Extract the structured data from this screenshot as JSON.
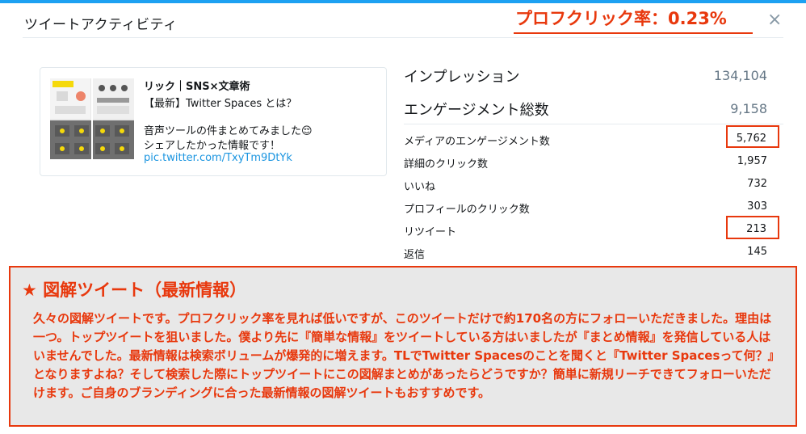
{
  "window": {
    "title": "ツイートアクティビティ",
    "close_glyph": "×",
    "accent_color": "#1da1f2"
  },
  "annotation": {
    "header_note": "プロフクリック率：0.23%",
    "color": "#e8380d"
  },
  "tweet": {
    "author": "リック｜SNS×文章術",
    "lines": [
      "【最新】Twitter Spaces とは？",
      "",
      "音声ツールの件まとめてみました😌",
      "シェアしたかった情報です！"
    ],
    "link": "pic.twitter.com/TxyTm9DtYk",
    "thumbnail_icon": "image-icon"
  },
  "metrics": {
    "impressions": {
      "label": "インプレッション",
      "value": "134,104"
    },
    "engagements": {
      "label": "エンゲージメント総数",
      "value": "9,158"
    },
    "rows": [
      {
        "label": "メディアのエンゲージメント数",
        "value": "5,762"
      },
      {
        "label": "詳細のクリック数",
        "value": "1,957"
      },
      {
        "label": "いいね",
        "value": "732"
      },
      {
        "label": "プロフィールのクリック数",
        "value": "303"
      },
      {
        "label": "リツイート",
        "value": "213"
      },
      {
        "label": "返信",
        "value": "145"
      }
    ]
  },
  "note": {
    "title": "★ 図解ツイート（最新情報）",
    "body": "久々の図解ツイートです。プロフクリック率を見れば低いですが、このツイートだけで約170名の方にフォローいただきました。理由は一つ。トップツイートを狙いました。僕より先に『簡単な情報』をツイートしている方はいましたが『まとめ情報』を発信している人はいませんでした。最新情報は検索ボリュームが爆発的に増えます。TLでTwitter Spacesのことを聞くと『Twitter Spacesって何？』となりますよね？そして検索した際にトップツイートにこの図解まとめがあったらどうですか？簡単に新規リーチできてフォローいただけます。ご自身のブランディングに合った最新情報の図解ツイートもおすすめです。"
  }
}
